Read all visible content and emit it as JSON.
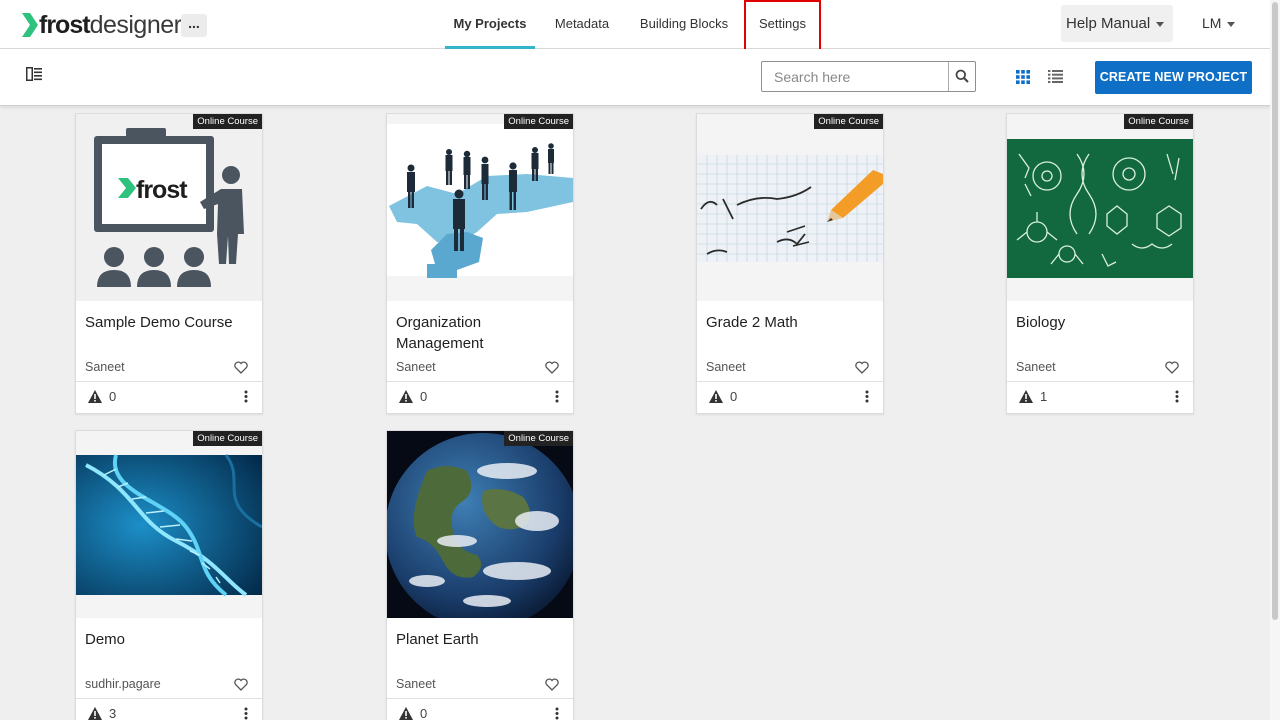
{
  "app": {
    "brand_bold": "frost",
    "brand_light": "designer",
    "more_label": "...",
    "accent_color": "#33b4c8",
    "primary_color": "#0f6fc6"
  },
  "nav": {
    "tabs": [
      {
        "label": "My Projects",
        "active": true
      },
      {
        "label": "Metadata",
        "active": false
      },
      {
        "label": "Building Blocks",
        "active": false
      },
      {
        "label": "Settings",
        "active": false
      }
    ],
    "help_label": "Help Manual",
    "user_initials": "LM"
  },
  "toolbar": {
    "search_placeholder": "Search here",
    "create_label": "CREATE NEW PROJECT",
    "view_mode": "grid"
  },
  "projects": [
    {
      "title": "Sample Demo Course",
      "author": "Saneet",
      "badge": "Online Course",
      "warnings": "0",
      "thumbnail": "frost-classroom-illustration"
    },
    {
      "title": "Organization Management",
      "author": "Saneet",
      "badge": "Online Course",
      "warnings": "0",
      "thumbnail": "business-people-on-puzzle"
    },
    {
      "title": "Grade 2 Math",
      "author": "Saneet",
      "badge": "Online Course",
      "warnings": "0",
      "thumbnail": "math-equation-with-pencil"
    },
    {
      "title": "Biology",
      "author": "Saneet",
      "badge": "Online Course",
      "warnings": "1",
      "thumbnail": "biology-chalkboard"
    },
    {
      "title": "Demo",
      "author": "sudhir.pagare",
      "badge": "Online Course",
      "warnings": "3",
      "thumbnail": "dna-helix"
    },
    {
      "title": "Planet Earth",
      "author": "Saneet",
      "badge": "Online Course",
      "warnings": "0",
      "thumbnail": "earth-from-space"
    }
  ]
}
